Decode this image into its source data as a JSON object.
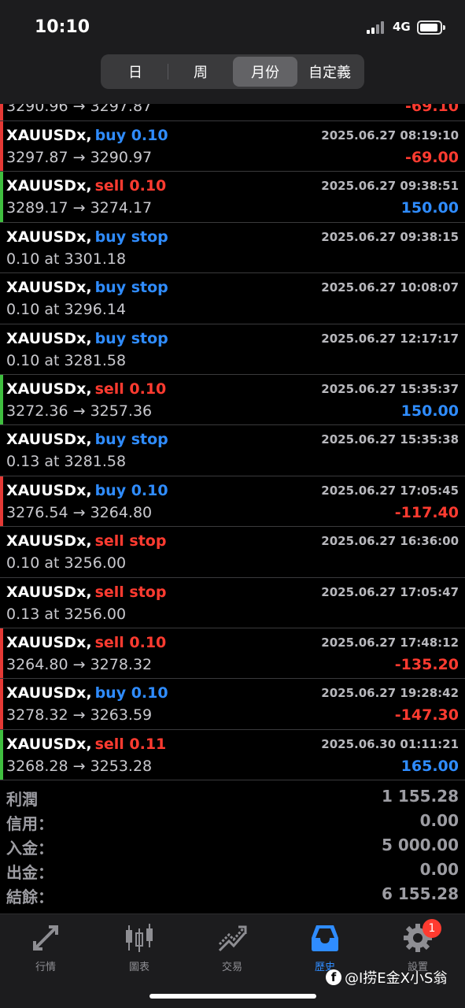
{
  "status_bar": {
    "time": "10:10",
    "network": "4G"
  },
  "period_tabs": [
    "日",
    "周",
    "月份",
    "自定義"
  ],
  "partial_row": {
    "prices": "3290.96 → 3297.87",
    "profit": "-69.10",
    "bar": "red",
    "profit_sign": "neg"
  },
  "trades": [
    {
      "symbol": "XAUUSDx,",
      "action": "buy 0.10",
      "side": "buy",
      "time": "2025.06.27 08:19:10",
      "detail": "3297.87 → 3290.97",
      "profit": "-69.00",
      "profit_sign": "neg",
      "bar": "red"
    },
    {
      "symbol": "XAUUSDx,",
      "action": "sell 0.10",
      "side": "sell",
      "time": "2025.06.27 09:38:51",
      "detail": "3289.17 → 3274.17",
      "profit": "150.00",
      "profit_sign": "pos",
      "bar": "green"
    },
    {
      "symbol": "XAUUSDx,",
      "action": "buy stop",
      "side": "buy",
      "time": "2025.06.27 09:38:15",
      "detail": "0.10 at 3301.18",
      "profit": "",
      "profit_sign": "",
      "bar": ""
    },
    {
      "symbol": "XAUUSDx,",
      "action": "buy stop",
      "side": "buy",
      "time": "2025.06.27 10:08:07",
      "detail": "0.10 at 3296.14",
      "profit": "",
      "profit_sign": "",
      "bar": ""
    },
    {
      "symbol": "XAUUSDx,",
      "action": "buy stop",
      "side": "buy",
      "time": "2025.06.27 12:17:17",
      "detail": "0.10 at 3281.58",
      "profit": "",
      "profit_sign": "",
      "bar": ""
    },
    {
      "symbol": "XAUUSDx,",
      "action": "sell 0.10",
      "side": "sell",
      "time": "2025.06.27 15:35:37",
      "detail": "3272.36 → 3257.36",
      "profit": "150.00",
      "profit_sign": "pos",
      "bar": "green"
    },
    {
      "symbol": "XAUUSDx,",
      "action": "buy stop",
      "side": "buy",
      "time": "2025.06.27 15:35:38",
      "detail": "0.13 at 3281.58",
      "profit": "",
      "profit_sign": "",
      "bar": ""
    },
    {
      "symbol": "XAUUSDx,",
      "action": "buy 0.10",
      "side": "buy",
      "time": "2025.06.27 17:05:45",
      "detail": "3276.54 → 3264.80",
      "profit": "-117.40",
      "profit_sign": "neg",
      "bar": "red"
    },
    {
      "symbol": "XAUUSDx,",
      "action": "sell stop",
      "side": "sell",
      "time": "2025.06.27 16:36:00",
      "detail": "0.10 at 3256.00",
      "profit": "",
      "profit_sign": "",
      "bar": ""
    },
    {
      "symbol": "XAUUSDx,",
      "action": "sell stop",
      "side": "sell",
      "time": "2025.06.27 17:05:47",
      "detail": "0.13 at 3256.00",
      "profit": "",
      "profit_sign": "",
      "bar": ""
    },
    {
      "symbol": "XAUUSDx,",
      "action": "sell 0.10",
      "side": "sell",
      "time": "2025.06.27 17:48:12",
      "detail": "3264.80 → 3278.32",
      "profit": "-135.20",
      "profit_sign": "neg",
      "bar": "red"
    },
    {
      "symbol": "XAUUSDx,",
      "action": "buy 0.10",
      "side": "buy",
      "time": "2025.06.27 19:28:42",
      "detail": "3278.32 → 3263.59",
      "profit": "-147.30",
      "profit_sign": "neg",
      "bar": "red"
    },
    {
      "symbol": "XAUUSDx,",
      "action": "sell 0.11",
      "side": "sell",
      "time": "2025.06.30 01:11:21",
      "detail": "3268.28 → 3253.28",
      "profit": "165.00",
      "profit_sign": "pos",
      "bar": "green"
    }
  ],
  "summary": [
    {
      "label": "利潤",
      "value": "1 155.28"
    },
    {
      "label": "信用：",
      "value": "0.00"
    },
    {
      "label": "入金：",
      "value": "5 000.00"
    },
    {
      "label": "出金：",
      "value": "0.00"
    },
    {
      "label": "結餘：",
      "value": "6 155.28"
    }
  ],
  "tabbar": [
    {
      "label": "行情",
      "icon": "quotes-arrows-icon"
    },
    {
      "label": "圖表",
      "icon": "candlestick-chart-icon"
    },
    {
      "label": "交易",
      "icon": "trade-trend-icon"
    },
    {
      "label": "歷史",
      "icon": "history-inbox-icon"
    },
    {
      "label": "設置",
      "icon": "gear-icon"
    }
  ],
  "settings_badge": "1",
  "watermark": "@I捞E金X小S翁",
  "colors": {
    "buy": "#2f8cff",
    "sell": "#ff3b30",
    "profit_bar": "#3fbf3f",
    "loss_bar": "#e53935"
  }
}
